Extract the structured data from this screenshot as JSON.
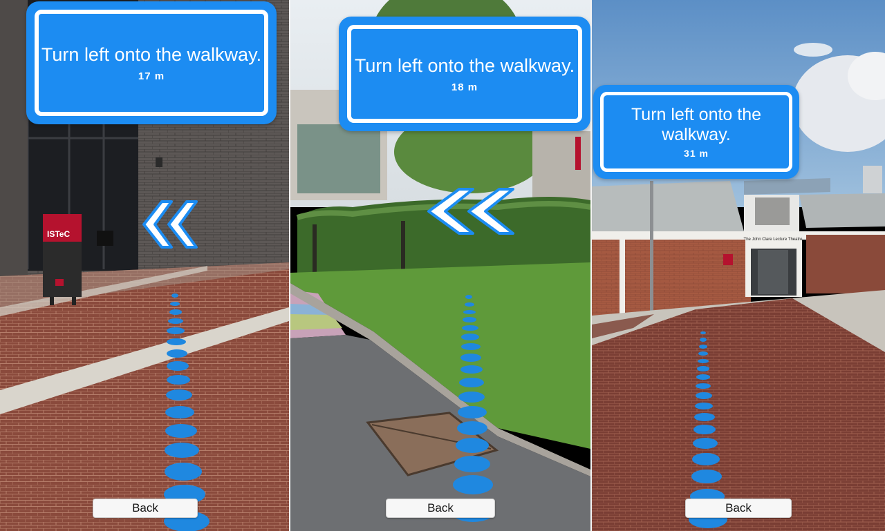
{
  "panels": [
    {
      "instruction": "Turn left onto the walkway.",
      "distance": "17 m",
      "back_label": "Back"
    },
    {
      "instruction": "Turn left onto the walkway.",
      "distance": "18 m",
      "back_label": "Back"
    },
    {
      "instruction": "Turn left onto the walkway.",
      "distance": "31 m",
      "back_label": "Back"
    }
  ],
  "scene_text": {
    "istec_sign": "ISTeC",
    "theatre_sign": "The John Clare Lecture Theatre"
  },
  "icons": {
    "direction": "double-chevron-left-icon",
    "path": "path-dots-icon"
  },
  "colors": {
    "sign_blue": "#1c8cf2",
    "path_blue": "#1f88e0",
    "sign_border": "#ffffff"
  }
}
